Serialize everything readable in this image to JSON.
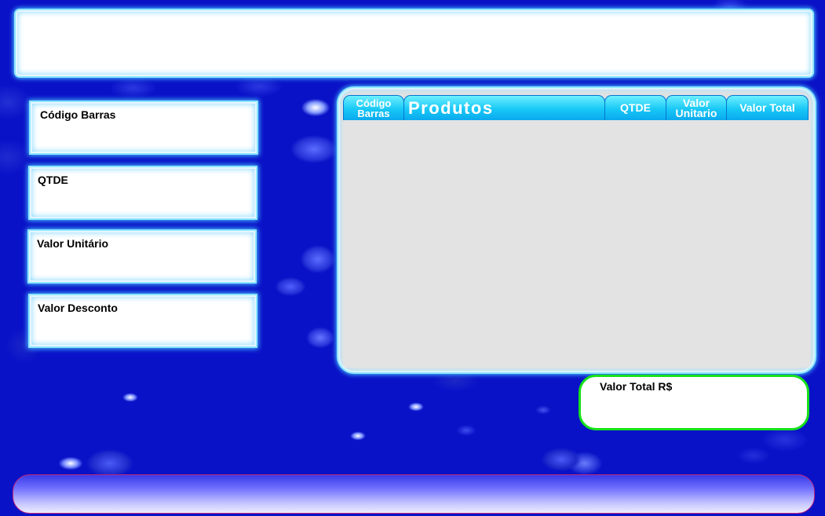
{
  "header": {
    "title": ""
  },
  "fields": [
    {
      "label": "Código Barras",
      "value": ""
    },
    {
      "label": "QTDE",
      "value": ""
    },
    {
      "label": "Valor Unitário",
      "value": ""
    },
    {
      "label": "Valor Desconto",
      "value": ""
    }
  ],
  "grid": {
    "columns": {
      "codigo_barras": [
        "Código",
        "Barras"
      ],
      "produtos": "Produtos",
      "qtde": "QTDE",
      "valor_unitario": [
        "Valor",
        "Unitario"
      ],
      "valor_total": "Valor Total"
    },
    "rows": []
  },
  "total": {
    "label": "Valor Total R$",
    "value": ""
  },
  "footer": {
    "text": ""
  },
  "colors": {
    "background": "#0a12c8",
    "panel_glow": "#48c8ff",
    "column_header": "#18c8f6",
    "total_border": "#16e11a"
  }
}
